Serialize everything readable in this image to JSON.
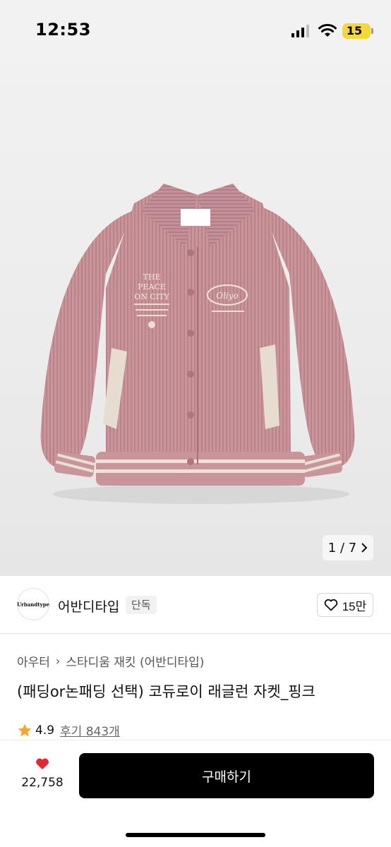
{
  "status_bar": {
    "time": "12:53",
    "battery": "15",
    "icons": [
      "signal-icon",
      "wifi-icon",
      "battery-icon"
    ]
  },
  "gallery": {
    "current": "1",
    "total": "7",
    "counter_text": "1 / 7",
    "jacket_prints": {
      "chest_text": [
        "THE",
        "PEACE",
        "ON CITY"
      ],
      "patch_script": "Oliyo"
    }
  },
  "seller": {
    "logo_text": "Urbandtype",
    "name": "어반디타입",
    "badge": "단독",
    "likes": "15만"
  },
  "product": {
    "breadcrumb": [
      "아우터",
      "스타디움 재킷 (어반디타입)"
    ],
    "title": "(패딩or논패딩 선택) 코듀로이 래글런 자켓_핑크",
    "rating": "4.9",
    "reviews": "후기 843개"
  },
  "bottom_bar": {
    "wish_count": "22,758",
    "buy_label": "구매하기"
  },
  "colors": {
    "jacket": "#c9959a",
    "buy_button": "#000000",
    "heart": "#e8262f",
    "star": "#f4a62a",
    "battery": "#f4d738"
  }
}
